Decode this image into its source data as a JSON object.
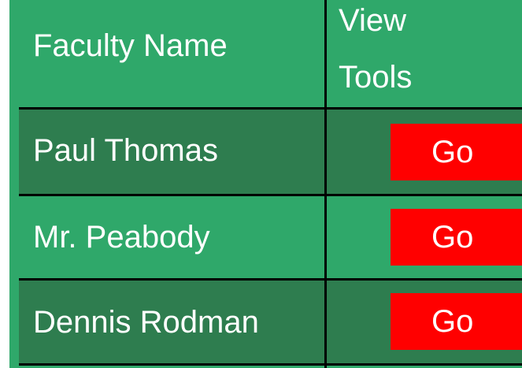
{
  "table": {
    "header": {
      "name_label": "Faculty Name",
      "tools_label_line1": "View",
      "tools_label_line2": "Tools"
    },
    "rows": [
      {
        "name": "Paul Thomas",
        "action": "Go"
      },
      {
        "name": "Mr. Peabody",
        "action": "Go"
      },
      {
        "name": "Dennis Rodman",
        "action": "Go"
      }
    ]
  },
  "colors": {
    "header_bg": "#2fa86a",
    "row_dark": "#2e7d4f",
    "row_light": "#2fa86a",
    "button_bg": "#ff0000",
    "text": "#ffffff",
    "grid_line": "#000000"
  }
}
